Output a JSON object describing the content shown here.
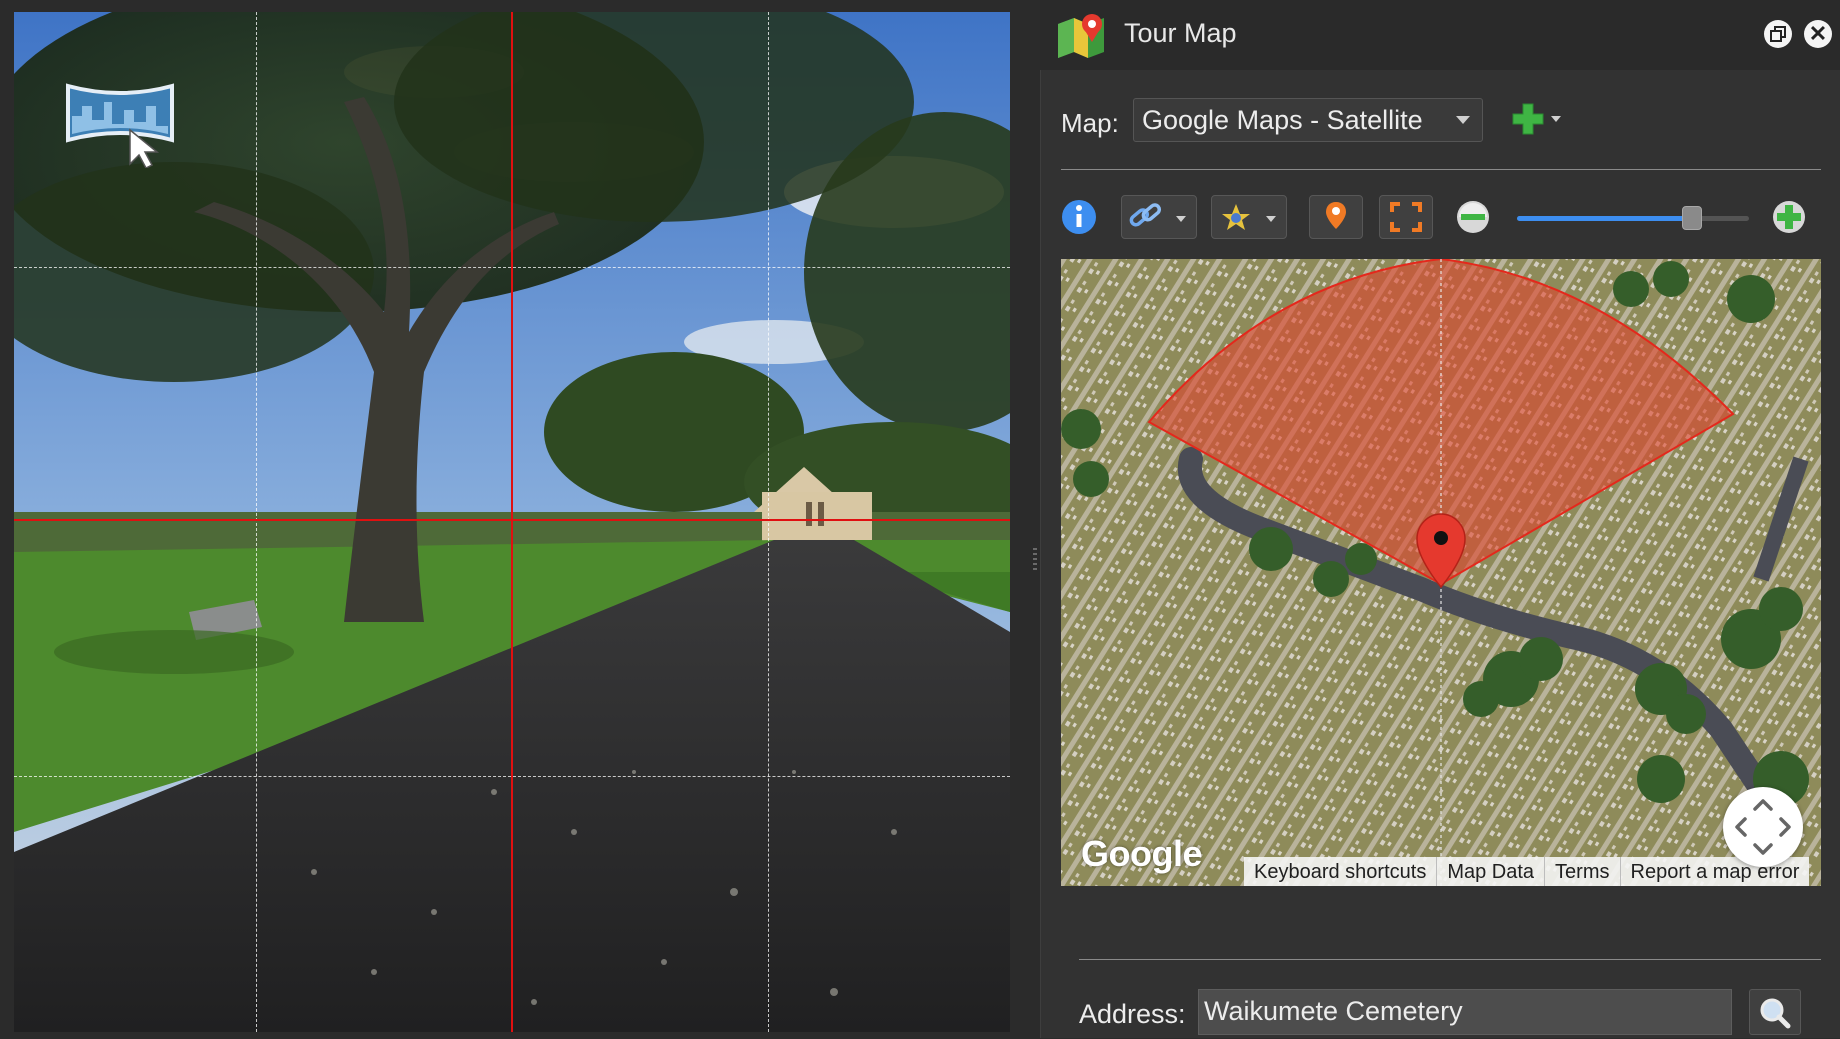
{
  "panel": {
    "title": "Tour Map",
    "map_label": "Map:",
    "map_provider": "Google Maps - Satellite",
    "address_label": "Address:",
    "address_value": "Waikumete Cemetery"
  },
  "icons": {
    "app": "tour-map-icon",
    "restore": "restore-icon",
    "close": "close-icon",
    "add_map": "plus-icon",
    "info": "info-icon",
    "link": "link-icon",
    "hotspot": "hotspot-icon",
    "pin": "map-pin-icon",
    "fullscreen": "fullscreen-icon",
    "zoom_out": "minus-icon",
    "zoom_in": "plus-icon",
    "search": "magnifier-icon",
    "panorama": "panorama-cursor-icon"
  },
  "zoom": {
    "level": 0.78
  },
  "map": {
    "logo": "Google",
    "attribution": [
      "Keyboard shortcuts",
      "Map Data",
      "Terms",
      "Report a map error"
    ]
  },
  "colors": {
    "accent_blue": "#3d8ef0",
    "crosshair_red": "#e01010",
    "add_green": "#3fb544",
    "pin_red": "#e5392e",
    "view_cone": "#e0452d"
  }
}
